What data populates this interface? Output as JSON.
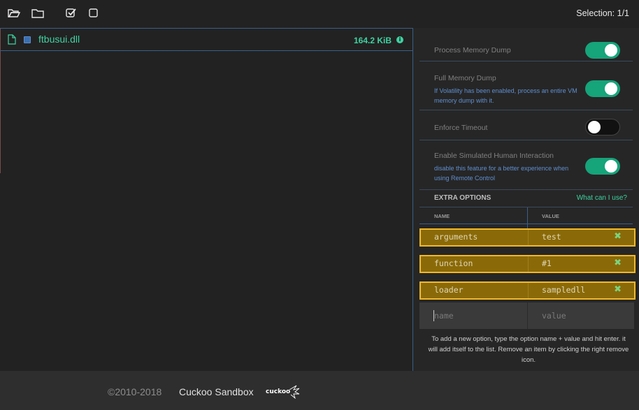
{
  "topbar": {
    "selection": "Selection: 1/1",
    "icons": [
      "folder-open-icon",
      "folder-icon",
      "check-square-icon",
      "square-icon"
    ]
  },
  "file": {
    "name": "ftbusui.dll",
    "size": "164.2 KiB",
    "icon": "file-icon"
  },
  "options": [
    {
      "label": "Process Memory Dump",
      "help": "",
      "enabled": true
    },
    {
      "label": "Full Memory Dump",
      "help": "If Volatility has been enabled, process an entire VM memory dump with it.",
      "enabled": true
    },
    {
      "label": "Enforce Timeout",
      "help": "",
      "enabled": false
    },
    {
      "label": "Enable Simulated Human Interaction",
      "help": "disable this feature for a better experience when using Remote Control",
      "enabled": true
    }
  ],
  "extra": {
    "title": "EXTRA OPTIONS",
    "link": "What can I use?",
    "col_name": "NAME",
    "col_value": "VALUE",
    "entries": [
      {
        "key": "arguments",
        "value": "test"
      },
      {
        "key": "function",
        "value": "#1"
      },
      {
        "key": "loader",
        "value": "sampledll"
      }
    ],
    "remove_glyph": "✖",
    "new_name_placeholder": "name",
    "new_value_placeholder": "value",
    "help": "To add a new option, type the option name + value and hit enter. it will add itself to the list. Remove an item by clicking the right remove icon."
  },
  "footer": {
    "copyright": "©2010-2018",
    "brand": "Cuckoo Sandbox",
    "logo_text": "cuckoo"
  },
  "colors": {
    "accent": "#3fd1a2",
    "toggle_on": "#16a47a",
    "highlight_border": "#f2b829",
    "highlight_fill": "#8a6a08",
    "help_blue": "#5f8fd0"
  }
}
